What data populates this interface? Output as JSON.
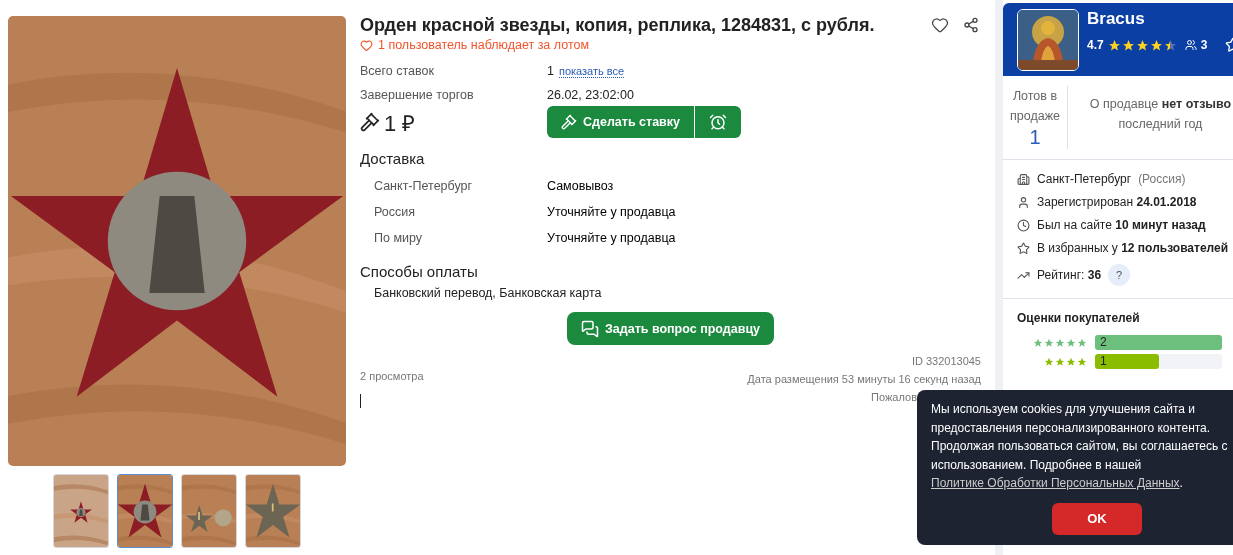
{
  "thumbnails": [
    {
      "selected": false
    },
    {
      "selected": true
    },
    {
      "selected": false
    },
    {
      "selected": false
    }
  ],
  "lot": {
    "title": "Орден красной звезды, копия, реплика, 1284831, с рубля.",
    "watchers": "1 пользователь наблюдает за лотом",
    "info": [
      {
        "label": "Всего ставок",
        "value": "1",
        "link": "показать все"
      },
      {
        "label": "Завершение торгов",
        "value": "26.02, 23:02:00"
      }
    ],
    "price": "1 ₽",
    "bid_button": "Сделать ставку"
  },
  "delivery": {
    "heading": "Доставка",
    "rows": [
      {
        "region": "Санкт-Петербург",
        "method": "Самовывоз"
      },
      {
        "region": "Россия",
        "method": "Уточняйте у продавца"
      },
      {
        "region": "По миру",
        "method": "Уточняйте у продавца"
      }
    ]
  },
  "payment": {
    "heading": "Способы оплаты",
    "text": "Банковский перевод, Банковская карта"
  },
  "ask_button": "Задать вопрос продавцу",
  "views": "2 просмотра",
  "lot_id": "ID 332013045",
  "posted": "Дата размещения 53 минуты 16 секунд назад",
  "report": "Пожалов",
  "seller": {
    "name": "Bracus",
    "rating": "4.7",
    "stars": 4.5,
    "followers": "3",
    "lots_label": "Лотов в продаже",
    "lots_count": "1",
    "reviews": "О продавце **нет отзыво**\nпоследний год",
    "details": [
      {
        "kind": "city",
        "text": "Санкт-Петербург",
        "note": "(Россия)"
      },
      {
        "kind": "registered",
        "text": "Зарегистрирован **24.01.2018**"
      },
      {
        "kind": "online",
        "text": "Был на сайте **10 минут назад**"
      },
      {
        "kind": "favorites",
        "text": "В избранных у **12 пользователей**"
      },
      {
        "kind": "rating",
        "text": "Рейтинг: **36**",
        "help": "?"
      }
    ],
    "ratings_heading": "Оценки покупателей",
    "ratings": [
      {
        "stars": 5,
        "count": "2",
        "level": 1,
        "color": "#6cbf7c"
      },
      {
        "stars": 4,
        "count": "1",
        "level": 0.5,
        "color": "#8abd00"
      }
    ]
  },
  "cookie": {
    "text": "Мы используем cookies для улучшения сайта и\nпредоставления персонализированного контента.\nПродолжая пользоваться сайтом, вы соглашаетесь с\nиспользованием. Подробнее в нашей ",
    "link": "Политике Обработки Персональных Данных",
    "end": ".",
    "ok": "OK"
  }
}
